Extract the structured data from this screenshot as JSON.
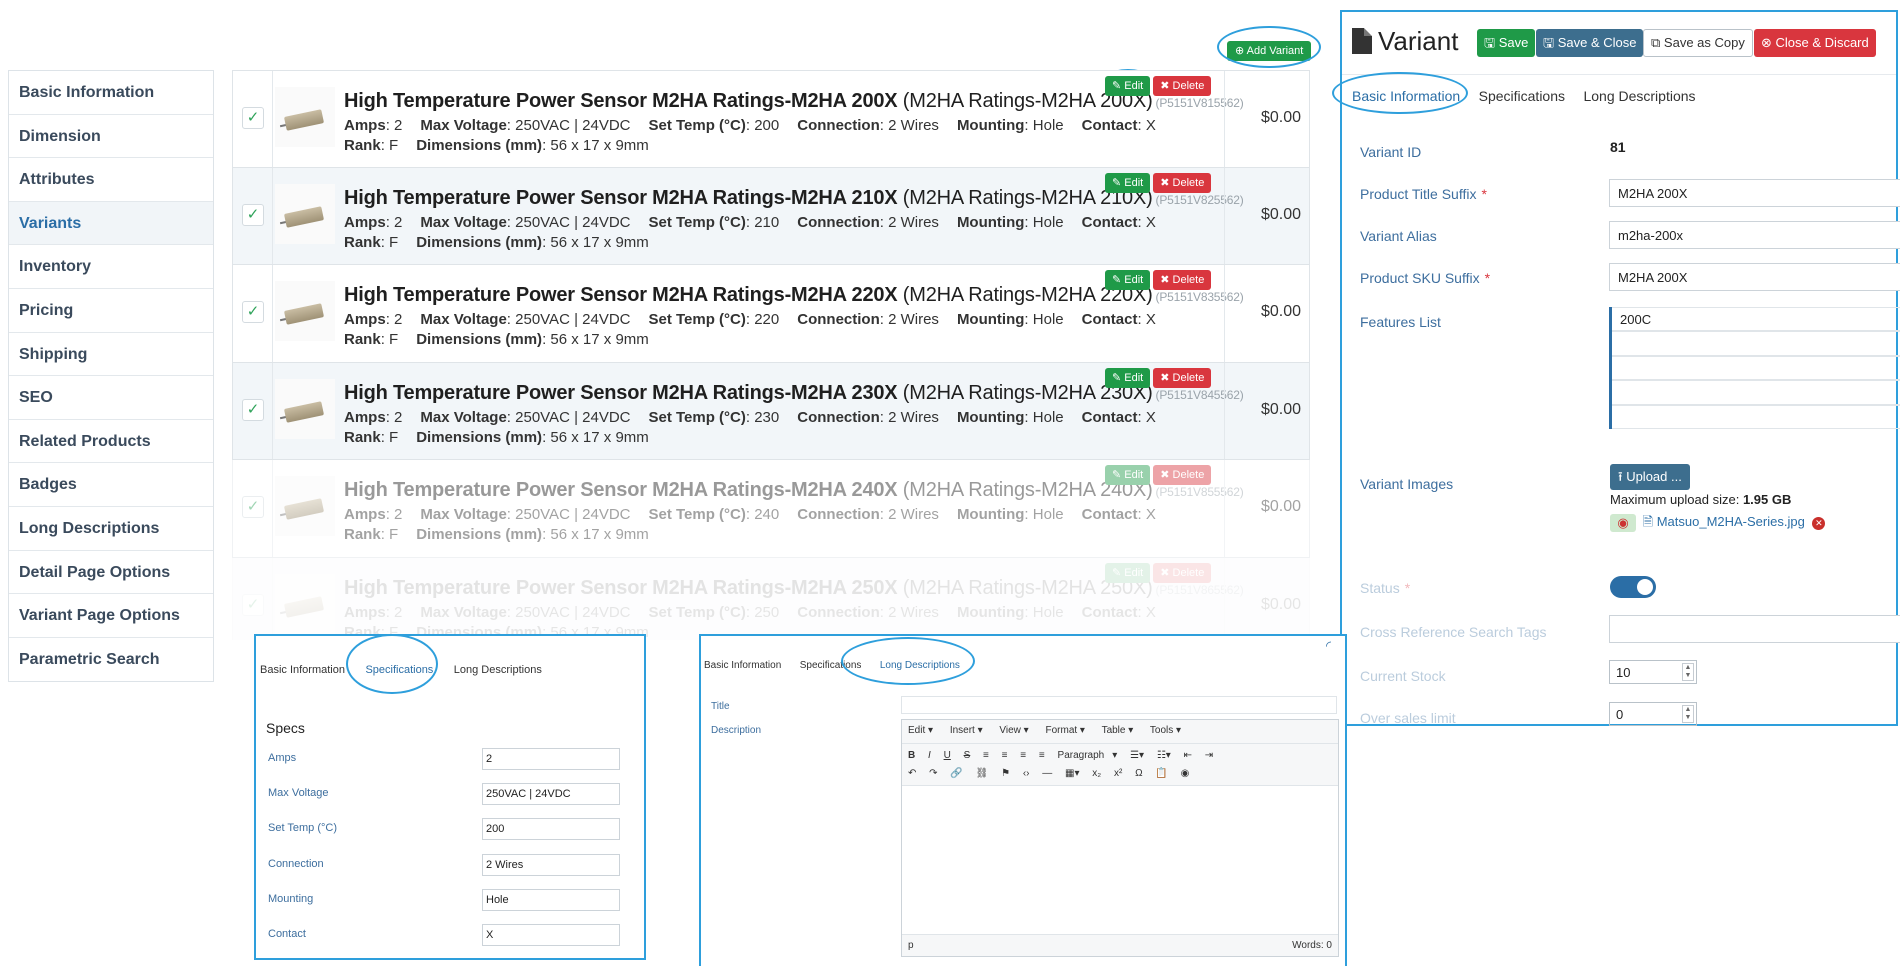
{
  "sidebar": {
    "items": [
      {
        "label": "Basic Information"
      },
      {
        "label": "Dimension"
      },
      {
        "label": "Attributes"
      },
      {
        "label": "Variants"
      },
      {
        "label": "Inventory"
      },
      {
        "label": "Pricing"
      },
      {
        "label": "Shipping"
      },
      {
        "label": "SEO"
      },
      {
        "label": "Related Products"
      },
      {
        "label": "Badges"
      },
      {
        "label": "Long Descriptions"
      },
      {
        "label": "Detail Page Options"
      },
      {
        "label": "Variant Page Options"
      },
      {
        "label": "Parametric Search"
      }
    ],
    "active_index": 3
  },
  "add_variant_label": "Add Variant",
  "variant_list": {
    "edit_label": "Edit",
    "delete_label": "Delete",
    "spec_labels": {
      "amps": "Amps",
      "max_voltage": "Max Voltage",
      "set_temp": "Set Temp (°C)",
      "connection": "Connection",
      "mounting": "Mounting",
      "contact": "Contact",
      "rank": "Rank",
      "dimensions": "Dimensions (mm)"
    },
    "rows": [
      {
        "title": "High Temperature Power Sensor M2HA Ratings-M2HA 200X",
        "sub": "(M2HA Ratings-M2HA 200X)",
        "sku": "(P5151V815562)",
        "amps": "2",
        "max_voltage": "250VAC | 24VDC",
        "set_temp": "200",
        "connection": "2 Wires",
        "mounting": "Hole",
        "contact": "X",
        "rank": "F",
        "dimensions": "56 x 17 x 9mm",
        "price": "$0.00"
      },
      {
        "title": "High Temperature Power Sensor M2HA Ratings-M2HA 210X",
        "sub": "(M2HA Ratings-M2HA 210X)",
        "sku": "(P5151V825562)",
        "amps": "2",
        "max_voltage": "250VAC | 24VDC",
        "set_temp": "210",
        "connection": "2 Wires",
        "mounting": "Hole",
        "contact": "X",
        "rank": "F",
        "dimensions": "56 x 17 x 9mm",
        "price": "$0.00"
      },
      {
        "title": "High Temperature Power Sensor M2HA Ratings-M2HA 220X",
        "sub": "(M2HA Ratings-M2HA 220X)",
        "sku": "(P5151V835562)",
        "amps": "2",
        "max_voltage": "250VAC | 24VDC",
        "set_temp": "220",
        "connection": "2 Wires",
        "mounting": "Hole",
        "contact": "X",
        "rank": "F",
        "dimensions": "56 x 17 x 9mm",
        "price": "$0.00"
      },
      {
        "title": "High Temperature Power Sensor M2HA Ratings-M2HA 230X",
        "sub": "(M2HA Ratings-M2HA 230X)",
        "sku": "(P5151V845562)",
        "amps": "2",
        "max_voltage": "250VAC | 24VDC",
        "set_temp": "230",
        "connection": "2 Wires",
        "mounting": "Hole",
        "contact": "X",
        "rank": "F",
        "dimensions": "56 x 17 x 9mm",
        "price": "$0.00"
      },
      {
        "title": "High Temperature Power Sensor M2HA Ratings-M2HA 240X",
        "sub": "(M2HA Ratings-M2HA 240X)",
        "sku": "(P5151V855562)",
        "amps": "2",
        "max_voltage": "250VAC | 24VDC",
        "set_temp": "240",
        "connection": "2 Wires",
        "mounting": "Hole",
        "contact": "X",
        "rank": "F",
        "dimensions": "56 x 17 x 9mm",
        "price": "$0.00"
      },
      {
        "title": "High Temperature Power Sensor M2HA Ratings-M2HA 250X",
        "sub": "(M2HA Ratings-M2HA 250X)",
        "sku": "(P5151V865562)",
        "amps": "2",
        "max_voltage": "250VAC | 24VDC",
        "set_temp": "250",
        "connection": "2 Wires",
        "mounting": "Hole",
        "contact": "X",
        "rank": "F",
        "dimensions": "56 x 17 x 9mm",
        "price": "$0.00"
      }
    ]
  },
  "variant_panel": {
    "title": "Variant",
    "buttons": {
      "save": "Save",
      "save_close": "Save & Close",
      "save_copy": "Save as Copy",
      "close_discard": "Close & Discard"
    },
    "tabs": [
      "Basic Information",
      "Specifications",
      "Long Descriptions"
    ],
    "fields": {
      "variant_id": {
        "label": "Variant ID",
        "value": "81"
      },
      "title_suffix": {
        "label": "Product Title Suffix",
        "value": "M2HA 200X"
      },
      "alias": {
        "label": "Variant Alias",
        "value": "m2ha-200x"
      },
      "sku_suffix": {
        "label": "Product SKU Suffix",
        "value": "M2HA 200X"
      },
      "features": {
        "label": "Features List",
        "value": "200C"
      },
      "images": {
        "label": "Variant Images",
        "upload_label": "Upload ...",
        "max_label": "Maximum upload size:",
        "max_value": "1.95 GB",
        "file_name": "Matsuo_M2HA-Series.jpg"
      },
      "status": {
        "label": "Status"
      },
      "cross_ref": {
        "label": "Cross Reference Search Tags",
        "value": ""
      },
      "current_stock": {
        "label": "Current Stock",
        "value": "10"
      },
      "oversales": {
        "label": "Over sales limit",
        "value": "0"
      }
    }
  },
  "specs_panel": {
    "tabs": [
      "Basic Information",
      "Specifications",
      "Long Descriptions"
    ],
    "heading": "Specs",
    "fields": [
      {
        "label": "Amps",
        "value": "2"
      },
      {
        "label": "Max Voltage",
        "value": "250VAC | 24VDC"
      },
      {
        "label": "Set Temp (°C)",
        "value": "200"
      },
      {
        "label": "Connection",
        "value": "2 Wires"
      },
      {
        "label": "Mounting",
        "value": "Hole"
      },
      {
        "label": "Contact",
        "value": "X"
      }
    ]
  },
  "longdesc_panel": {
    "tabs": [
      "Basic Information",
      "Specifications",
      "Long Descriptions"
    ],
    "title_label": "Title",
    "description_label": "Description",
    "menus": [
      "Edit ▾",
      "Insert ▾",
      "View ▾",
      "Format ▾",
      "Table ▾",
      "Tools ▾"
    ],
    "paragraph_label": "Paragraph",
    "status_tag": "p",
    "words_label": "Words: 0"
  }
}
